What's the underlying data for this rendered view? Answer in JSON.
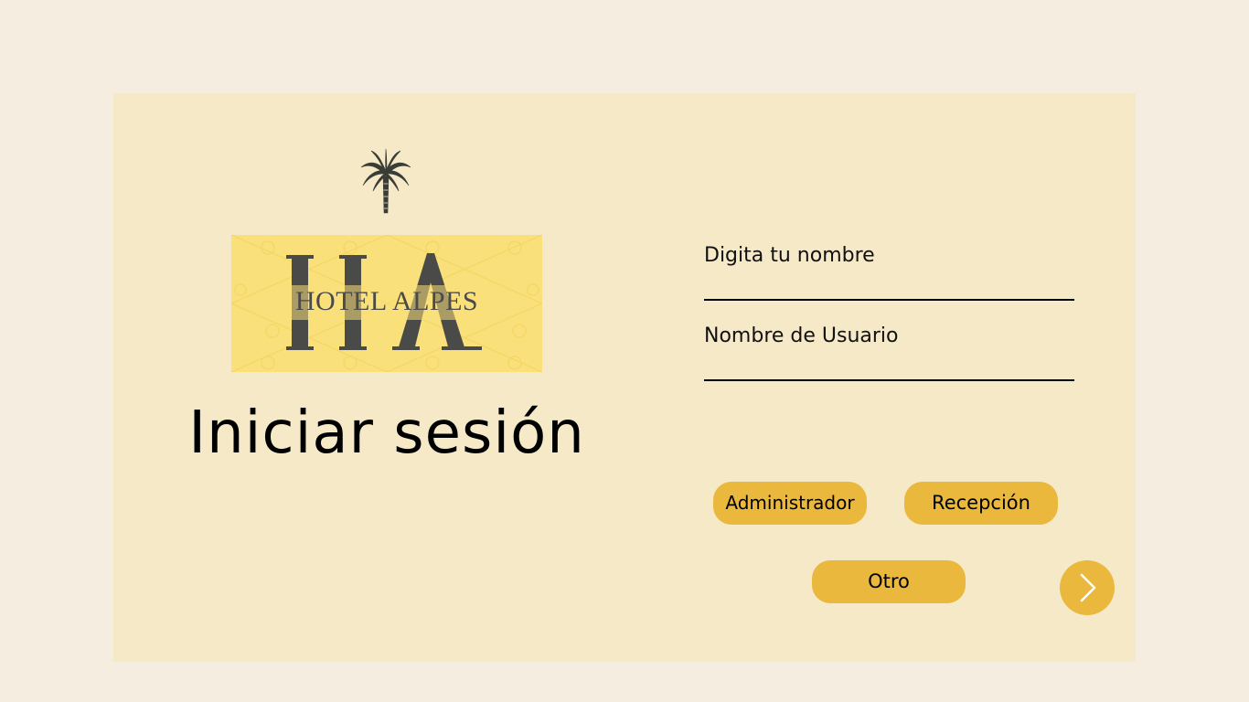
{
  "logo": {
    "monogram": "HA",
    "name": "HOTEL ALPES",
    "icon": "palm-tree-icon"
  },
  "login": {
    "title": "Iniciar sesión"
  },
  "form": {
    "nombre_label": "Digita tu nombre",
    "nombre_value": "",
    "usuario_label": "Nombre de Usuario",
    "usuario_value": ""
  },
  "roles": {
    "admin": "Administrador",
    "recepcion": "Recepción",
    "otro": "Otro"
  },
  "next": {
    "icon": "chevron-right-icon"
  },
  "colors": {
    "page_background": "#f5ede0",
    "card_background": "#f5e9c8",
    "logo_background": "#f9e07a",
    "accent": "#ebb83e",
    "logo_ink": "#4a4a48"
  }
}
